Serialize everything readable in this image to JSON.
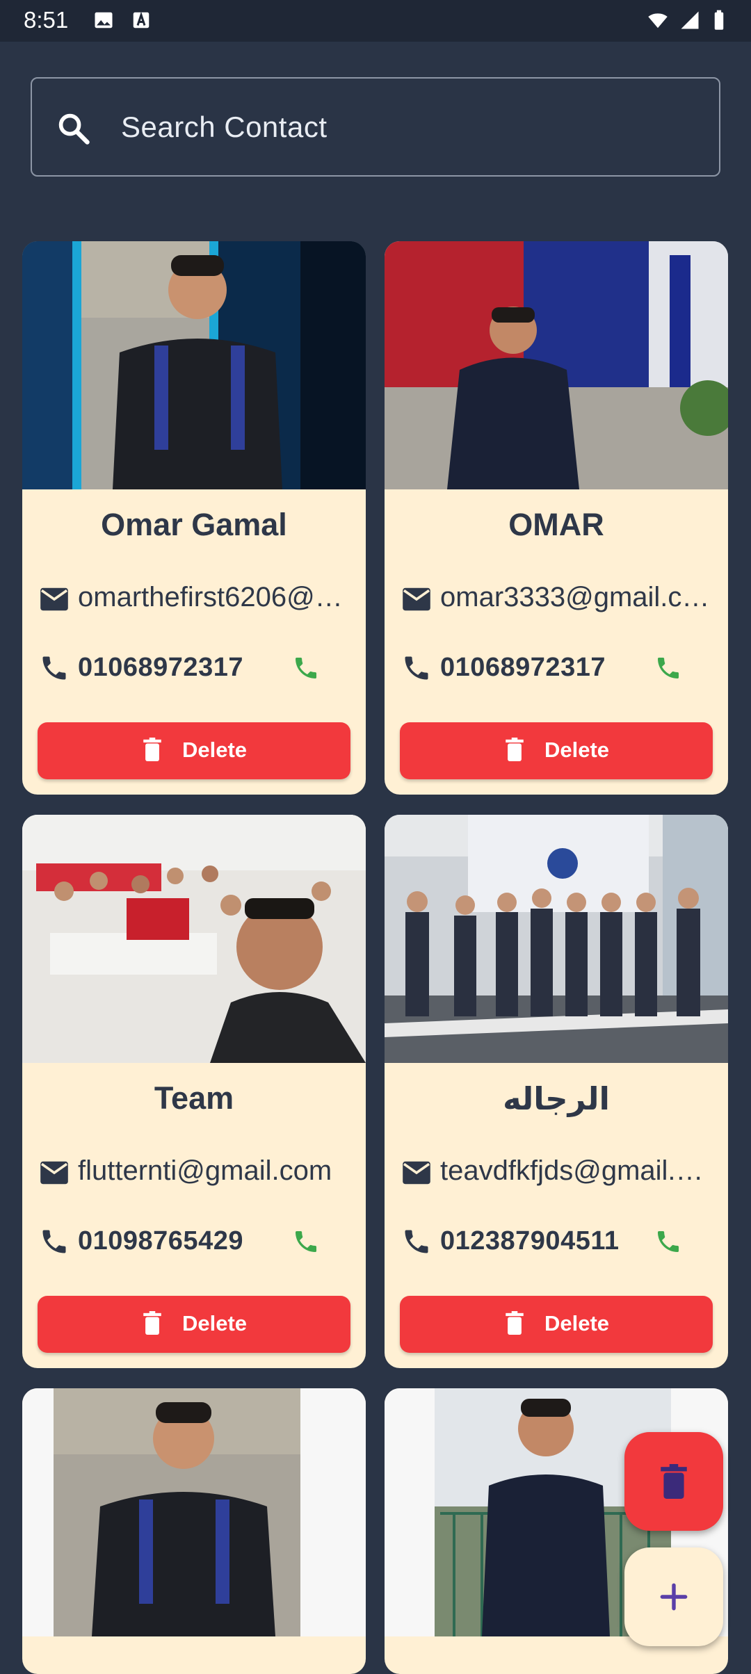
{
  "status_bar": {
    "time": "8:51"
  },
  "search": {
    "placeholder": "Search Contact"
  },
  "contacts": [
    {
      "name": "Omar Gamal",
      "email": "omarthefirst6206@…",
      "phone": "01068972317",
      "delete_label": "Delete"
    },
    {
      "name": "OMAR",
      "email": "omar3333@gmail.c…",
      "phone": "01068972317",
      "delete_label": "Delete"
    },
    {
      "name": "Team",
      "email": "flutternti@gmail.com",
      "phone": "01098765429",
      "delete_label": "Delete"
    },
    {
      "name": "الرجاله",
      "email": "teavdfkfjds@gmail.…",
      "phone": "012387904511",
      "delete_label": "Delete"
    }
  ],
  "colors": {
    "background": "#2a3446",
    "card": "#fff0d4",
    "delete": "#f2393d",
    "call": "#3ca84b",
    "text": "#2e3748",
    "add_icon": "#5a3fa8"
  },
  "icons": {
    "search": "search-icon",
    "email": "mail-icon",
    "phone": "phone-icon",
    "call": "call-icon",
    "delete": "trash-icon",
    "add": "plus-icon"
  }
}
